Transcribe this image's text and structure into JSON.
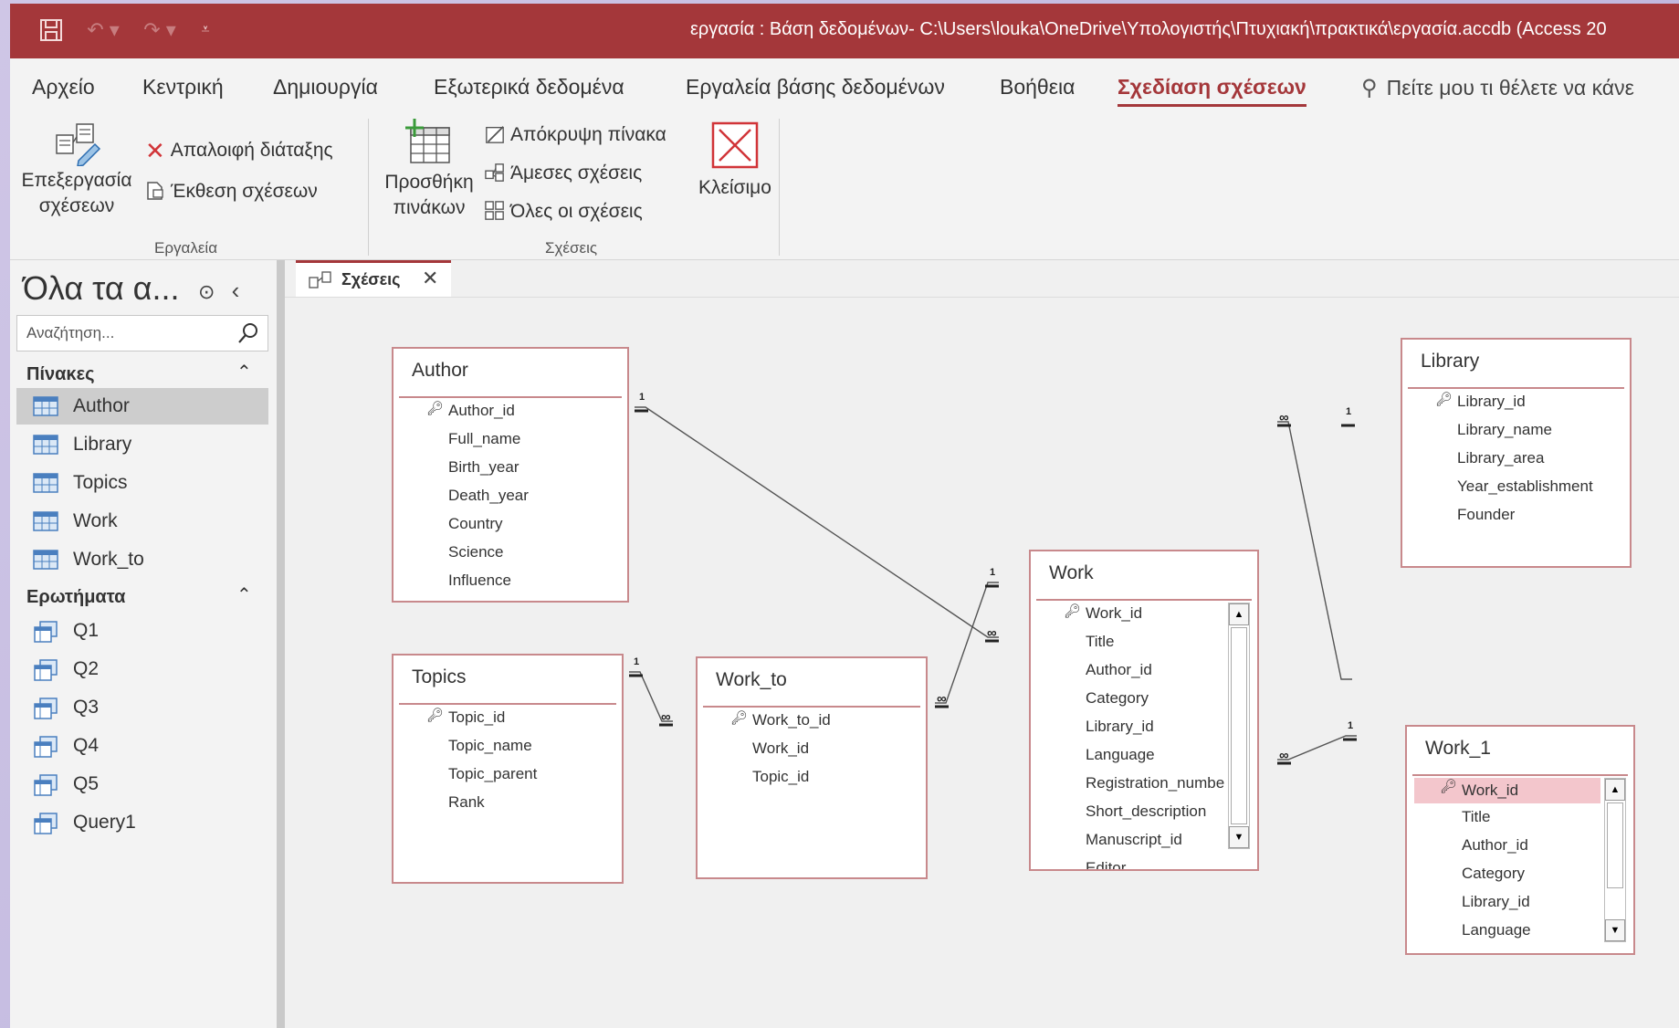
{
  "window": {
    "title": "εργασία : Βάση δεδομένων- C:\\Users\\louka\\OneDrive\\Υπολογιστής\\Πτυχιακή\\πρακτικά\\εργασία.accdb (Access 20"
  },
  "tabs": [
    {
      "label": "Αρχείο"
    },
    {
      "label": "Κεντρική"
    },
    {
      "label": "Δημιουργία"
    },
    {
      "label": "Εξωτερικά δεδομένα"
    },
    {
      "label": "Εργαλεία βάσης δεδομένων"
    },
    {
      "label": "Βοήθεια"
    },
    {
      "label": "Σχεδίαση σχέσεων"
    }
  ],
  "tell_me": "Πείτε μου τι θέλετε να κάνε",
  "ribbon": {
    "tools_group": "Εργαλεία",
    "edit_rel_line1": "Επεξεργασία",
    "edit_rel_line2": "σχέσεων",
    "clear_layout": "Απαλοιφή διάταξης",
    "rel_report": "Έκθεση σχέσεων",
    "rels_group": "Σχέσεις",
    "add_tables_line1": "Προσθήκη",
    "add_tables_line2": "πινάκων",
    "hide_table": "Απόκρυψη πίνακα",
    "direct_rels": "Άμεσες σχέσεις",
    "all_rels": "Όλες οι σχέσεις",
    "close": "Κλείσιμο"
  },
  "nav": {
    "title": "Όλα τα α...",
    "search_placeholder": "Αναζήτηση...",
    "sections": [
      {
        "title": "Πίνακες",
        "items": [
          {
            "label": "Author"
          },
          {
            "label": "Library"
          },
          {
            "label": "Topics"
          },
          {
            "label": "Work"
          },
          {
            "label": "Work_to"
          }
        ]
      },
      {
        "title": "Ερωτήματα",
        "items": [
          {
            "label": "Q1"
          },
          {
            "label": "Q2"
          },
          {
            "label": "Q3"
          },
          {
            "label": "Q4"
          },
          {
            "label": "Q5"
          },
          {
            "label": "Query1"
          }
        ]
      }
    ]
  },
  "doc_tab": "Σχέσεις",
  "tables": {
    "author": {
      "name": "Author",
      "fields": [
        "Author_id",
        "Full_name",
        "Birth_year",
        "Death_year",
        "Country",
        "Science",
        "Influence"
      ]
    },
    "topics": {
      "name": "Topics",
      "fields": [
        "Topic_id",
        "Topic_name",
        "Topic_parent",
        "Rank"
      ]
    },
    "work_to": {
      "name": "Work_to",
      "fields": [
        "Work_to_id",
        "Work_id",
        "Topic_id"
      ]
    },
    "work": {
      "name": "Work",
      "fields": [
        "Work_id",
        "Title",
        "Author_id",
        "Category",
        "Library_id",
        "Language",
        "Registration_numbe",
        "Short_description",
        "Manuscript_id",
        "Editor"
      ]
    },
    "library": {
      "name": "Library",
      "fields": [
        "Library_id",
        "Library_name",
        "Library_area",
        "Year_establishment",
        "Founder"
      ]
    },
    "work_1": {
      "name": "Work_1",
      "fields": [
        "Work_id",
        "Title",
        "Author_id",
        "Category",
        "Library_id",
        "Language"
      ]
    }
  },
  "relationships": {
    "one": "1",
    "many": "∞"
  }
}
